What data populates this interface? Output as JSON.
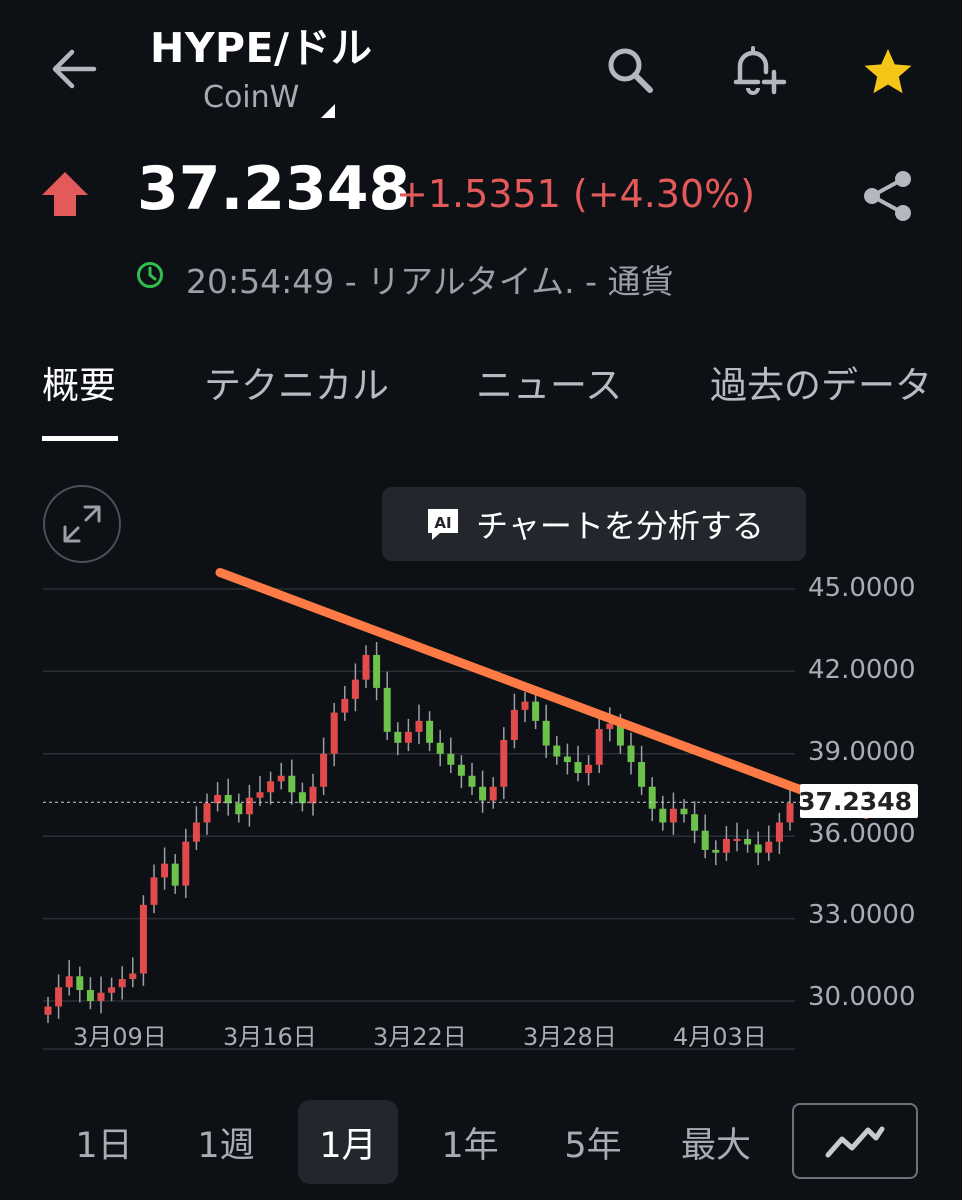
{
  "header": {
    "title": "HYPE/ドル",
    "exchange": "CoinW",
    "icons": [
      "back-arrow-icon",
      "search-icon",
      "add-alert-icon",
      "star-icon"
    ]
  },
  "quote": {
    "price": "37.2348",
    "change": "+1.5351 (+4.30%)",
    "status": "20:54:49 - リアルタイム. - 通貨",
    "direction": "up",
    "up_color": "#e45a5a",
    "clock_color": "#2fbf4f",
    "star_color": "#f5c518"
  },
  "tabs": [
    {
      "label": "概要",
      "active": true
    },
    {
      "label": "テクニカル",
      "active": false
    },
    {
      "label": "ニュース",
      "active": false
    },
    {
      "label": "過去のデータ",
      "active": false
    }
  ],
  "ai_button": {
    "badge": "AI",
    "label": "チャートを分析する"
  },
  "chart_data": {
    "type": "candlestick",
    "y_ticks": [
      "45.0000",
      "42.0000",
      "39.0000",
      "36.0000",
      "33.0000",
      "30.0000"
    ],
    "ylim": [
      30,
      45
    ],
    "x_ticks": [
      "3月09日",
      "3月16日",
      "3月22日",
      "3月28日",
      "4月03日"
    ],
    "last_price_label": "37.2348",
    "last_price": 37.2348,
    "trendline": {
      "start": 45.6,
      "end": 36.8,
      "color": "#ff7b45"
    },
    "up_color": "#e24b4b",
    "down_color": "#6cc24a",
    "closes": [
      29.8,
      30.5,
      30.9,
      30.4,
      30.0,
      30.3,
      30.5,
      30.8,
      31.0,
      33.5,
      34.5,
      35.0,
      34.2,
      35.8,
      36.5,
      37.2,
      37.5,
      37.2,
      36.8,
      37.4,
      37.6,
      38.0,
      38.2,
      37.6,
      37.2,
      37.8,
      39.0,
      40.5,
      41.0,
      41.7,
      42.6,
      41.4,
      39.8,
      39.4,
      39.8,
      40.2,
      39.4,
      39.0,
      38.6,
      38.2,
      37.8,
      37.3,
      37.8,
      39.5,
      40.6,
      40.9,
      40.2,
      39.3,
      38.9,
      38.7,
      38.3,
      38.6,
      39.9,
      40.1,
      39.3,
      38.7,
      37.8,
      37.0,
      36.5,
      37.0,
      36.8,
      36.2,
      35.5,
      35.4,
      35.9,
      35.9,
      35.7,
      35.4,
      35.8,
      36.5,
      37.2
    ]
  },
  "periods": [
    {
      "label": "1日",
      "active": false
    },
    {
      "label": "1週",
      "active": false
    },
    {
      "label": "1月",
      "active": true
    },
    {
      "label": "1年",
      "active": false
    },
    {
      "label": "5年",
      "active": false
    },
    {
      "label": "最大",
      "active": false
    }
  ]
}
